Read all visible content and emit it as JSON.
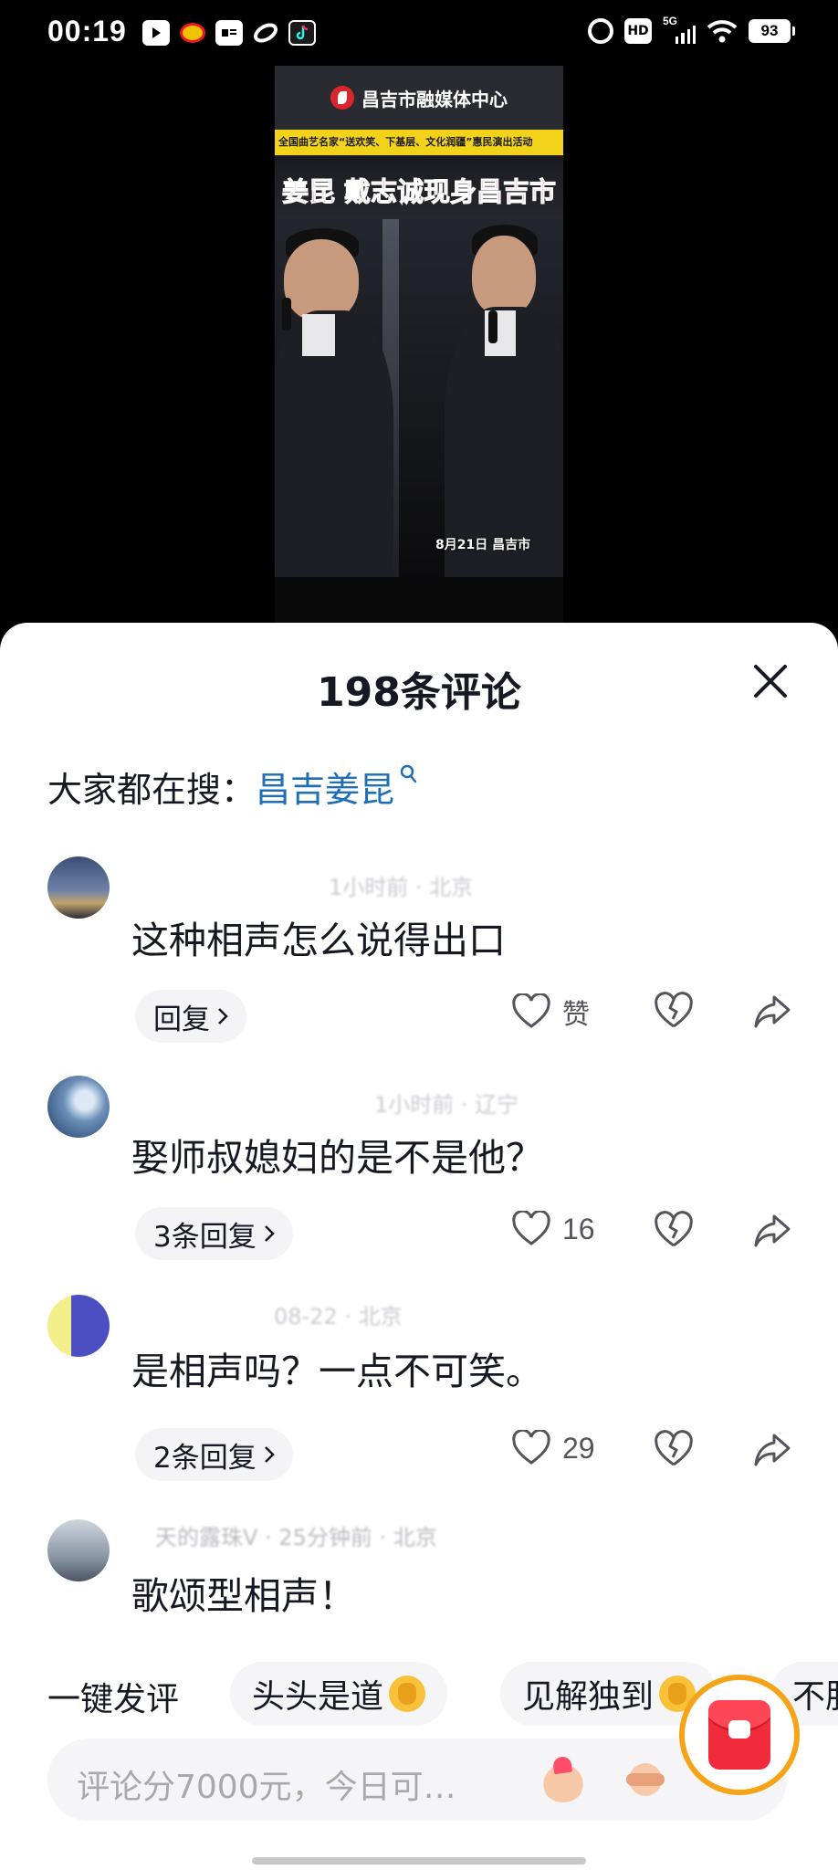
{
  "status_bar": {
    "time": "00:19",
    "notification_icons": [
      "play-app-icon",
      "weibo-icon",
      "toutiao-icon",
      "link-icon",
      "tiktok-icon"
    ],
    "system_icons": [
      "alarm-icon",
      "hd-icon",
      "5g-signal-icon",
      "wifi-icon",
      "battery-icon"
    ],
    "hd_label": "HD",
    "network_label": "5G",
    "battery_level": "93"
  },
  "video": {
    "logo_text": "昌吉市融媒体中心",
    "banner_text": "全国曲艺名家“送欢笑、下基层、文化润疆”惠民演出活动",
    "headline": "姜昆 戴志诚现身昌吉市",
    "date_caption": "8月21日 昌吉市"
  },
  "comments_panel": {
    "title": "198条评论",
    "search_prefix": "大家都在搜：",
    "search_term": "昌吉姜昆",
    "comments": [
      {
        "meta": "1小时前 · 北京",
        "text": "这种相声怎么说得出口",
        "reply_label": "回复",
        "like_count": "赞"
      },
      {
        "meta": "1小时前 · 辽宁",
        "text": "娶师叔媳妇的是不是他？",
        "reply_label": "3条回复",
        "like_count": "16"
      },
      {
        "meta": "08-22 · 北京",
        "text": "是相声吗？一点不可笑。",
        "reply_label": "2条回复",
        "like_count": "29"
      },
      {
        "meta": "天的露珠V · 25分钟前 · 北京",
        "text": "歌颂型相声！"
      }
    ],
    "quick_reply_label": "一键发评",
    "quick_replies": [
      "头头是道",
      "见解独到",
      "不服"
    ],
    "input_placeholder": "评论分7000元，今日可…"
  },
  "colors": {
    "accent_link": "#1f6fb8",
    "text_primary": "#161823",
    "text_secondary": "#54555c",
    "chip_bg": "#f5f5f7",
    "redpacket": "#f22b3c"
  }
}
